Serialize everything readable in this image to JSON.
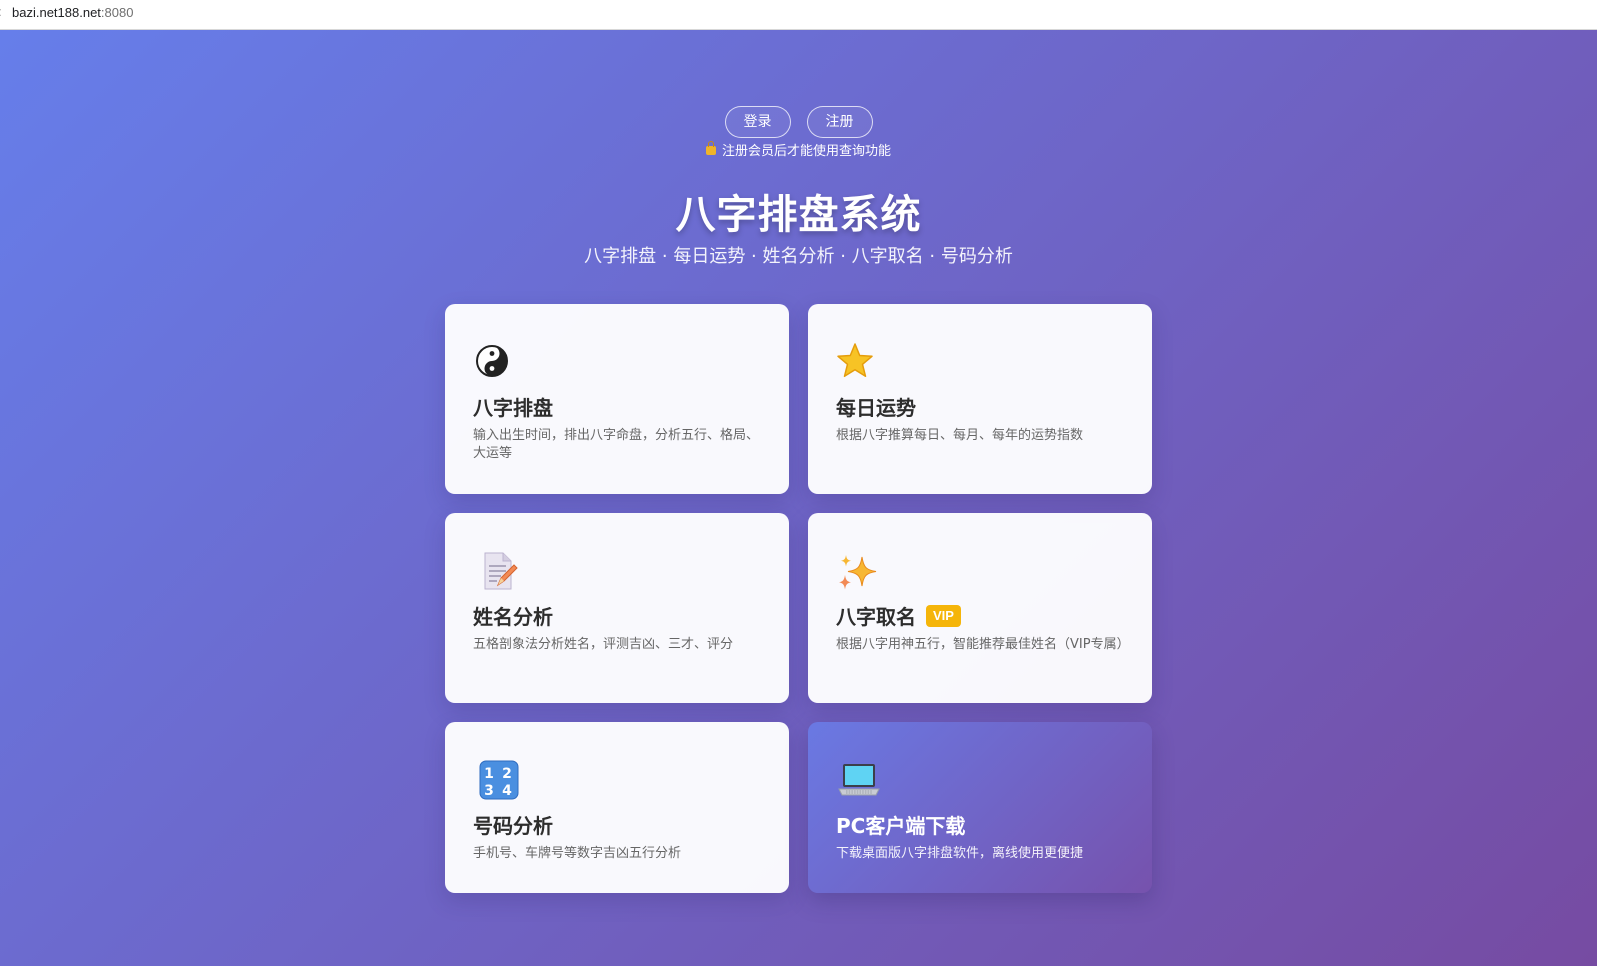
{
  "browser": {
    "url_host": "bazi.net188.net",
    "url_port": ":8080"
  },
  "auth": {
    "login_label": "登录",
    "register_label": "注册",
    "notice": "注册会员后才能使用查询功能"
  },
  "header": {
    "title": "八字排盘系统",
    "subtitle": "八字排盘 · 每日运势 · 姓名分析 · 八字取名 · 号码分析"
  },
  "cards": [
    {
      "icon": "yin-yang-icon",
      "title": "八字排盘",
      "desc": "输入出生时间，排出八字命盘，分析五行、格局、大运等"
    },
    {
      "icon": "star-icon",
      "title": "每日运势",
      "desc": "根据八字推算每日、每月、每年的运势指数"
    },
    {
      "icon": "memo-pencil-icon",
      "title": "姓名分析",
      "desc": "五格剖象法分析姓名，评测吉凶、三才、评分"
    },
    {
      "icon": "sparkles-icon",
      "title": "八字取名",
      "badge": "VIP",
      "desc": "根据八字用神五行，智能推荐最佳姓名（VIP专属）"
    },
    {
      "icon": "numbers-icon",
      "title": "号码分析",
      "desc": "手机号、车牌号等数字吉凶五行分析"
    },
    {
      "icon": "laptop-icon",
      "title": "PC客户端下载",
      "desc": "下载桌面版八字排盘软件，离线使用更便捷"
    }
  ],
  "colors": {
    "gradient_start": "#667eea",
    "gradient_end": "#764ba2",
    "vip_badge": "#f5b50a"
  }
}
